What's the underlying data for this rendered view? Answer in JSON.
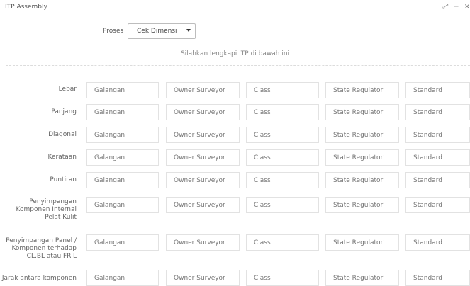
{
  "window": {
    "title": "ITP Assembly"
  },
  "form": {
    "proses_label": "Proses",
    "proses_value": "Cek Dimensi",
    "instruction": "Silahkan lengkapi ITP di bawah ini",
    "placeholders": [
      "Galangan",
      "Owner Surveyor",
      "Class",
      "State Regulator",
      "Standard"
    ],
    "rows": [
      {
        "label": "Lebar"
      },
      {
        "label": "Panjang"
      },
      {
        "label": "Diagonal"
      },
      {
        "label": "Kerataan"
      },
      {
        "label": "Puntiran"
      },
      {
        "label": "Penyimpangan Komponen Internal Pelat Kulit"
      },
      {
        "label": "Penyimpangan Panel / Komponen terhadap CL.BL atau FR.L"
      },
      {
        "label": "Jarak antara komponen"
      }
    ]
  }
}
